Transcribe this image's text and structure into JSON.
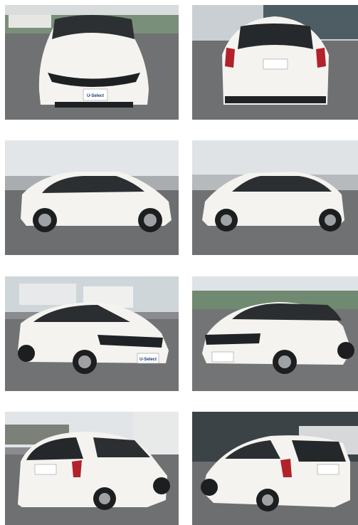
{
  "gallery": {
    "photos": [
      {
        "view": "front",
        "plate_text": "U-Select"
      },
      {
        "view": "rear",
        "plate_text": ""
      },
      {
        "view": "side-left",
        "plate_text": ""
      },
      {
        "view": "side-right",
        "plate_text": ""
      },
      {
        "view": "front-three-quarter-left",
        "plate_text": "U-Select"
      },
      {
        "view": "front-three-quarter-right",
        "plate_text": ""
      },
      {
        "view": "rear-three-quarter-left",
        "plate_text": ""
      },
      {
        "view": "rear-three-quarter-right",
        "plate_text": ""
      }
    ]
  },
  "colors": {
    "car_body": "#f4f3ef",
    "asphalt": "#77797b",
    "sky": "#dfe3e6"
  }
}
